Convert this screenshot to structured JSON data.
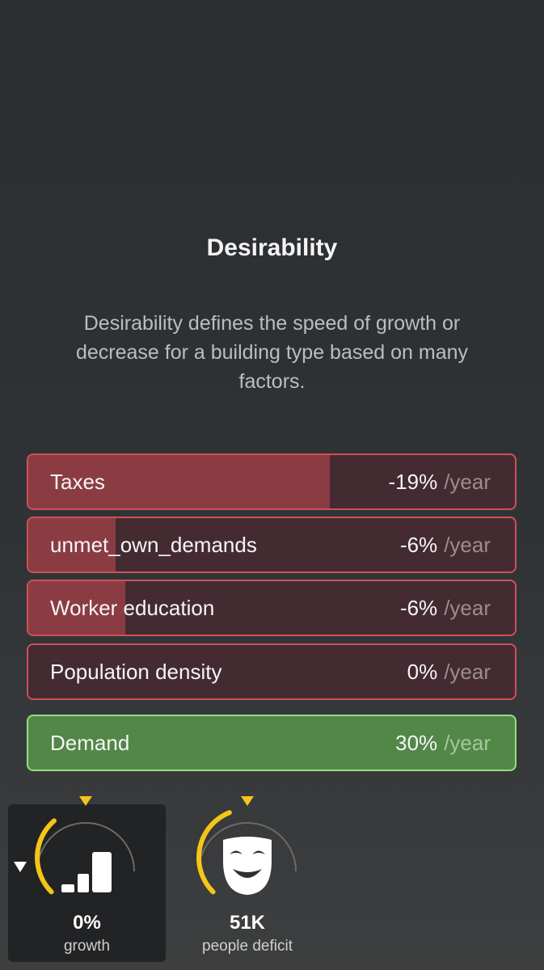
{
  "panel": {
    "title": "Desirability",
    "description": "Desirability defines the speed of growth or decrease for a building type based on many factors."
  },
  "factors": [
    {
      "name": "Taxes",
      "value": "-19%",
      "unit": "/year",
      "bar_fraction": 0.62
    },
    {
      "name": "unmet_own_demands",
      "value": "-6%",
      "unit": "/year",
      "bar_fraction": 0.18
    },
    {
      "name": "Worker education",
      "value": "-6%",
      "unit": "/year",
      "bar_fraction": 0.2
    },
    {
      "name": "Population density",
      "value": "0%",
      "unit": "/year",
      "bar_fraction": 0.0
    }
  ],
  "demand": {
    "name": "Demand",
    "value": "30%",
    "unit": "/year"
  },
  "gauges": {
    "growth": {
      "value": "0%",
      "label": "growth",
      "icon": "bar-chart-icon",
      "level": 0.35
    },
    "people": {
      "value": "51K",
      "label": "people deficit",
      "icon": "theater-mask-icon",
      "level": 0.42
    }
  },
  "colors": {
    "negative_border": "#cf5057",
    "negative_fill": "#8b3c43",
    "positive_border": "#8fe07c",
    "positive_fill": "#528747",
    "gauge_accent": "#f5c518"
  }
}
